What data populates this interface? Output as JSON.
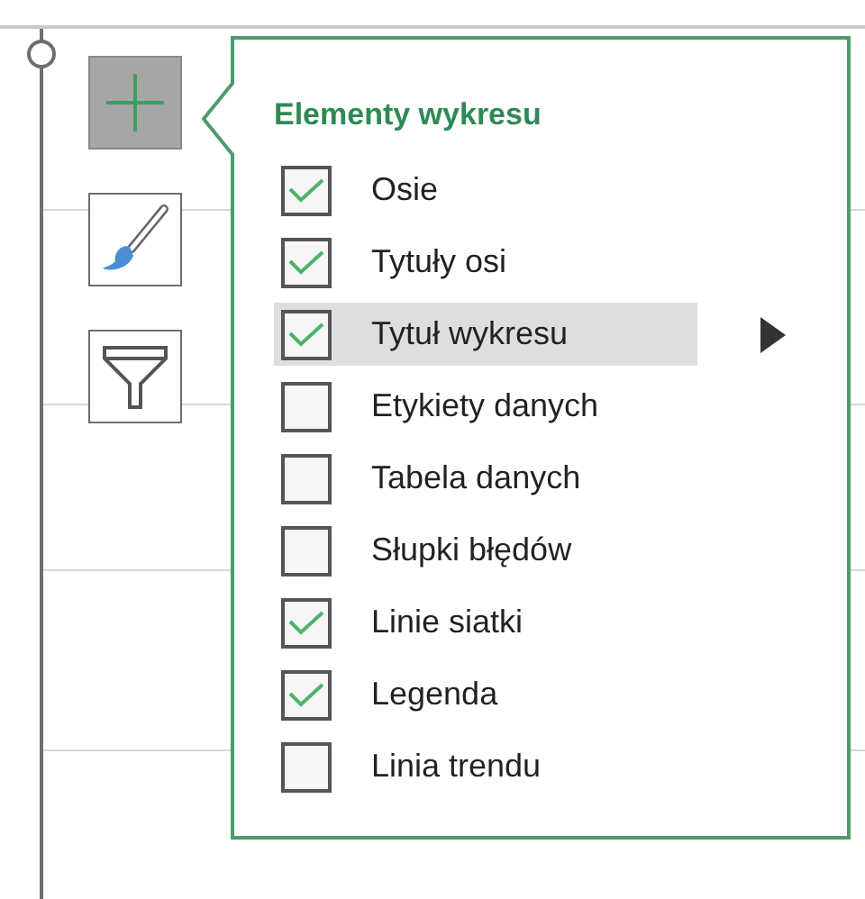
{
  "flyout": {
    "title": "Elementy wykresu",
    "items": [
      {
        "label": "Osie",
        "checked": true,
        "selected": false
      },
      {
        "label": "Tytuły osi",
        "checked": true,
        "selected": false
      },
      {
        "label": "Tytuł wykresu",
        "checked": true,
        "selected": true
      },
      {
        "label": "Etykiety danych",
        "checked": false,
        "selected": false
      },
      {
        "label": "Tabela danych",
        "checked": false,
        "selected": false
      },
      {
        "label": "Słupki błędów",
        "checked": false,
        "selected": false
      },
      {
        "label": "Linie siatki",
        "checked": true,
        "selected": false
      },
      {
        "label": "Legenda",
        "checked": true,
        "selected": false
      },
      {
        "label": "Linia trendu",
        "checked": false,
        "selected": false
      }
    ]
  },
  "side_buttons": [
    {
      "kind": "elements",
      "selected": true
    },
    {
      "kind": "styles",
      "selected": false
    },
    {
      "kind": "filters",
      "selected": false
    }
  ]
}
